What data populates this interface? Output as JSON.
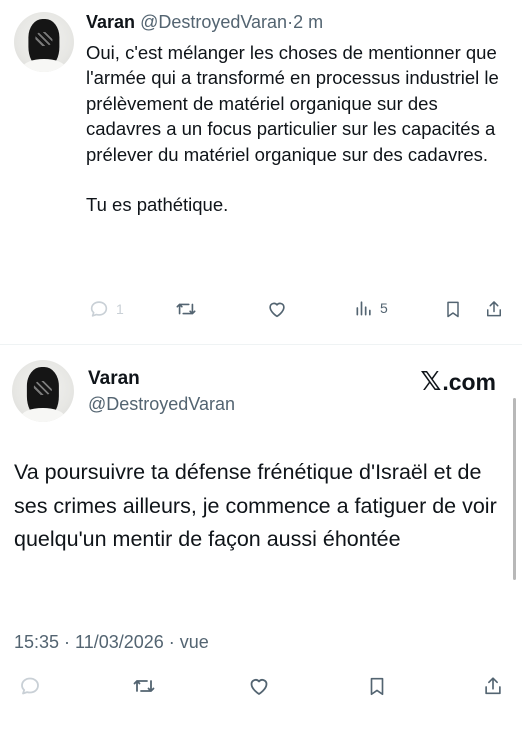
{
  "reply": {
    "name": "Varan",
    "handle": "@DestroyedVaran",
    "separator": "·",
    "time": "2 m",
    "paragraphs": [
      "Oui, c'est mélanger les choses de mentionner que l'armée qui a transformé en processus industriel le prélèvement de matériel organique sur des cadavres a un focus particulier sur les capacités a prélever du matériel organique sur des cadavres.",
      "Tu es pathétique."
    ],
    "reply_count": "1",
    "views_count": "5"
  },
  "tweet": {
    "name": "Varan",
    "handle": "@DestroyedVaran",
    "source_mark": "𝕏",
    "source_text": ".com",
    "text": "Va poursuivre ta défense frénétique d'Israël et de ses crimes ailleurs, je commence a fatiguer de voir quelqu'un mentir de façon aussi éhontée",
    "timestamp": "15:35 · 11/03/2026 · vue"
  },
  "icons": {
    "reply": "reply-icon",
    "retweet": "retweet-icon",
    "like": "heart-icon",
    "views": "views-icon",
    "bookmark": "bookmark-icon",
    "share": "share-icon"
  },
  "colors": {
    "text": "#0f1419",
    "muted": "#536471",
    "dim_icon": "#c9d0d6"
  }
}
